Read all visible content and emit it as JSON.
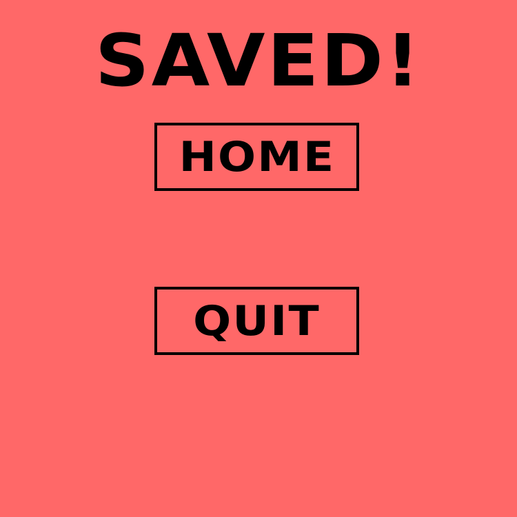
{
  "screen": {
    "background_color": "#ff6868",
    "text_color": "#000000",
    "title": "SAVED!"
  },
  "buttons": {
    "home_label": "HOME",
    "quit_label": "QUIT"
  }
}
